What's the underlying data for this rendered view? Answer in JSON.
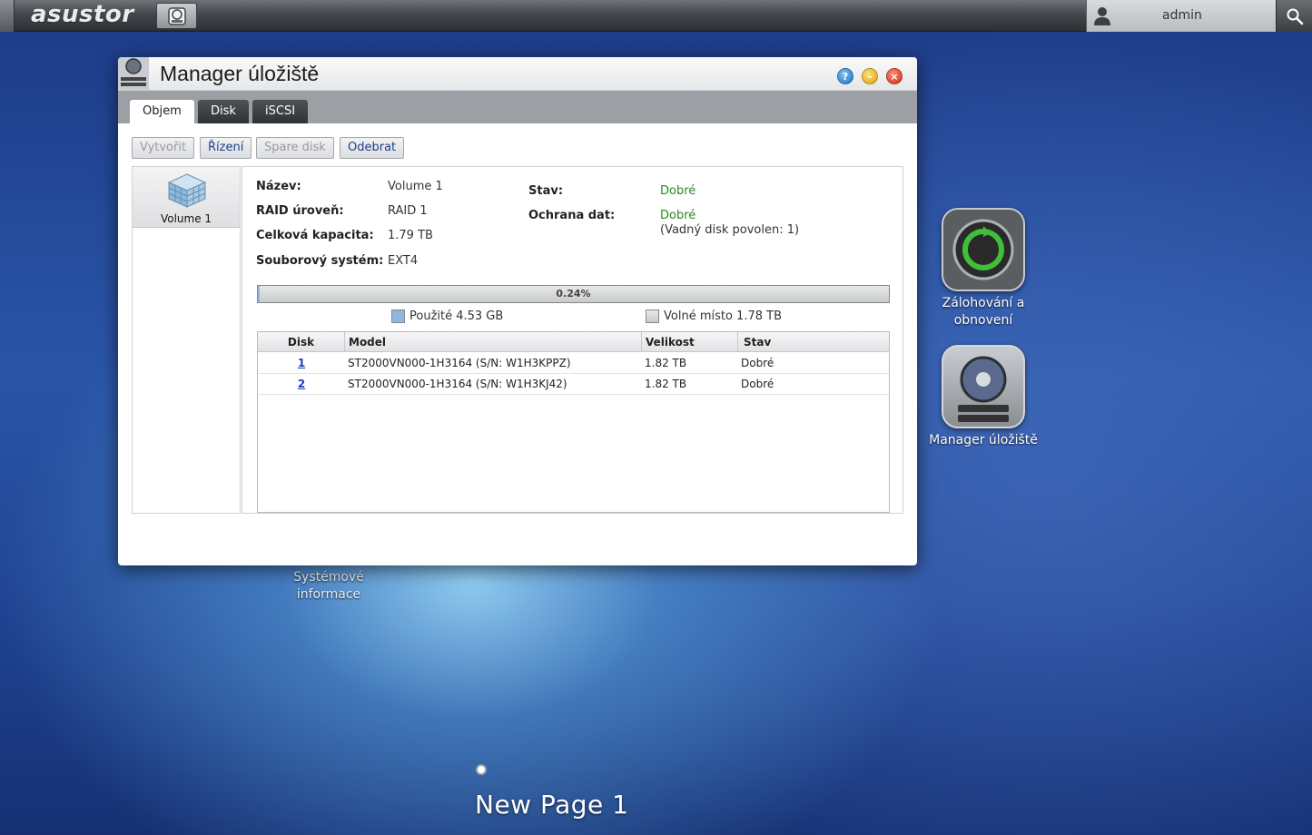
{
  "topbar": {
    "logo": "asustor",
    "user": "admin"
  },
  "desktop": {
    "icons": [
      {
        "label_line1": "Zálohování a",
        "label_line2": "obnovení"
      },
      {
        "label_line1": "Manager úložiště"
      },
      {
        "label_line1": "Systémové",
        "label_line2": "informace"
      }
    ],
    "page_name": "New Page 1"
  },
  "window": {
    "title": "Manager úložiště",
    "tabs": [
      "Objem",
      "Disk",
      "iSCSI"
    ],
    "active_tab": "Objem",
    "toolbar": {
      "create": "Vytvořit",
      "manage": "Řízení",
      "spare": "Spare disk",
      "remove": "Odebrat"
    },
    "sidebar": {
      "items": [
        {
          "label": "Volume 1"
        }
      ]
    },
    "info": {
      "name_label": "Název:",
      "name_value": "Volume 1",
      "raid_label": "RAID úroveň:",
      "raid_value": "RAID 1",
      "capacity_label": "Celková kapacita:",
      "capacity_value": "1.79 TB",
      "fs_label": "Souborový systém:",
      "fs_value": "EXT4",
      "status_label": "Stav:",
      "status_value": "Dobré",
      "protection_label": "Ochrana dat:",
      "protection_value": "Dobré",
      "protection_note": "(Vadný disk povolen: 1)"
    },
    "usage": {
      "percent_text": "0.24%",
      "percent": 0.24,
      "used_label": "Použité 4.53 GB",
      "free_label": "Volné místo 1.78 TB"
    },
    "disk_table": {
      "headers": [
        "Disk",
        "Model",
        "Velikost",
        "Stav"
      ],
      "rows": [
        [
          "1",
          "ST2000VN000-1H3164 (S/N: W1H3KPPZ)",
          "1.82 TB",
          "Dobré"
        ],
        [
          "2",
          "ST2000VN000-1H3164 (S/N: W1H3KJ42)",
          "1.82 TB",
          "Dobré"
        ]
      ]
    }
  },
  "colors": {
    "ok": "#2a8a1e",
    "link": "#1a3fbf",
    "used_swatch": "#8fb8e0"
  }
}
